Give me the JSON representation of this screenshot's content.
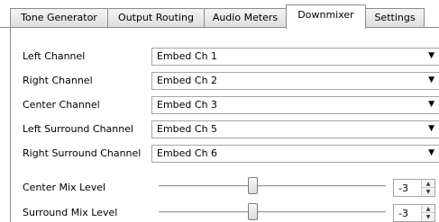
{
  "tabs": [
    {
      "label": "Tone Generator",
      "active": false
    },
    {
      "label": "Output Routing",
      "active": false
    },
    {
      "label": "Audio Meters",
      "active": false
    },
    {
      "label": "Downmixer",
      "active": true
    },
    {
      "label": "Settings",
      "active": false
    }
  ],
  "channels": [
    {
      "label": "Left Channel",
      "value": "Embed Ch 1"
    },
    {
      "label": "Right Channel",
      "value": "Embed Ch 2"
    },
    {
      "label": "Center Channel",
      "value": "Embed Ch 3"
    },
    {
      "label": "Left Surround Channel",
      "value": "Embed Ch 5"
    },
    {
      "label": "Right Surround Channel",
      "value": "Embed Ch 6"
    }
  ],
  "mix_levels": [
    {
      "label": "Center Mix Level",
      "value": "-3"
    },
    {
      "label": "Surround Mix Level",
      "value": "-3"
    }
  ],
  "icons": {
    "dropdown": "▼",
    "spin_up": "▲",
    "spin_down": "▼"
  }
}
